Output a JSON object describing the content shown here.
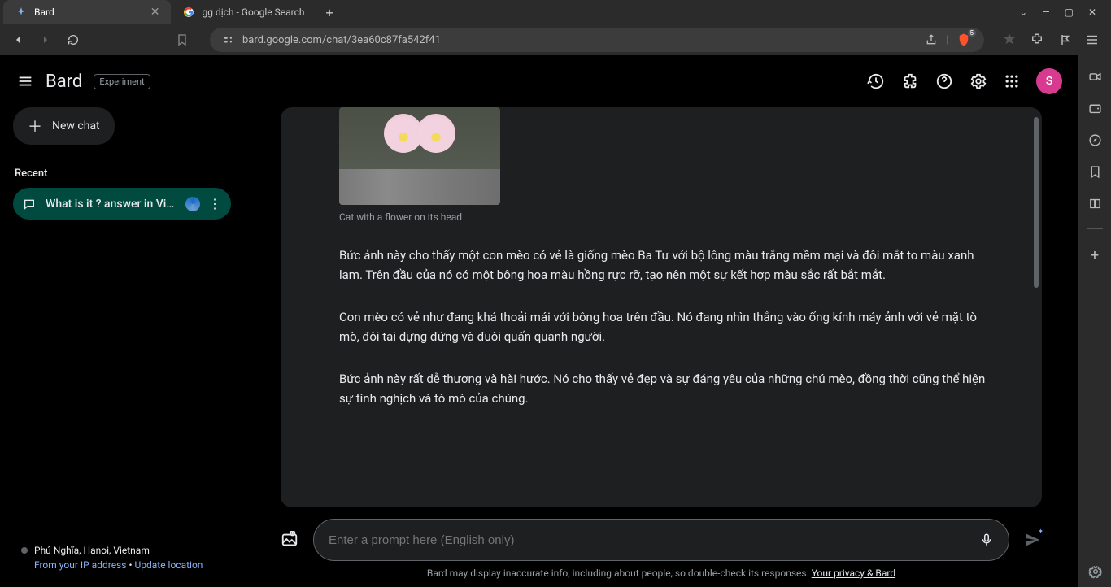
{
  "browser": {
    "tabs": [
      {
        "title": "Bard",
        "active": true
      },
      {
        "title": "gg dịch - Google Search",
        "active": false
      }
    ],
    "url": "bard.google.com/chat/3ea60c87fa542f41",
    "shield_count": "5"
  },
  "header": {
    "product": "Bard",
    "badge": "Experiment",
    "avatar_initial": "S"
  },
  "sidebar": {
    "new_chat": "New chat",
    "recent_label": "Recent",
    "chat_item_title": "What is it ? answer in Viet...",
    "location": "Phú Nghĩa, Hanoi, Vietnam",
    "ip_prefix": "From your IP address",
    "update_location": "Update location"
  },
  "response": {
    "image_caption": "Cat with a flower on its head",
    "p1": "Bức ảnh này cho thấy một con mèo có vẻ là giống mèo Ba Tư với bộ lông màu trắng mềm mại và đôi mắt to màu xanh lam. Trên đầu của nó có một bông hoa màu hồng rực rỡ, tạo nên một sự kết hợp màu sắc rất bắt mắt.",
    "p2": "Con mèo có vẻ như đang khá thoải mái với bông hoa trên đầu. Nó đang nhìn thẳng vào ống kính máy ảnh với vẻ mặt tò mò, đôi tai dựng đứng và đuôi quấn quanh người.",
    "p3": "Bức ảnh này rất dễ thương và hài hước. Nó cho thấy vẻ đẹp và sự đáng yêu của những chú mèo, đồng thời cũng thể hiện sự tinh nghịch và tò mò của chúng."
  },
  "input": {
    "placeholder": "Enter a prompt here (English only)"
  },
  "disclaimer": {
    "text": "Bard may display inaccurate info, including about people, so double-check its responses.",
    "link": "Your privacy & Bard"
  }
}
